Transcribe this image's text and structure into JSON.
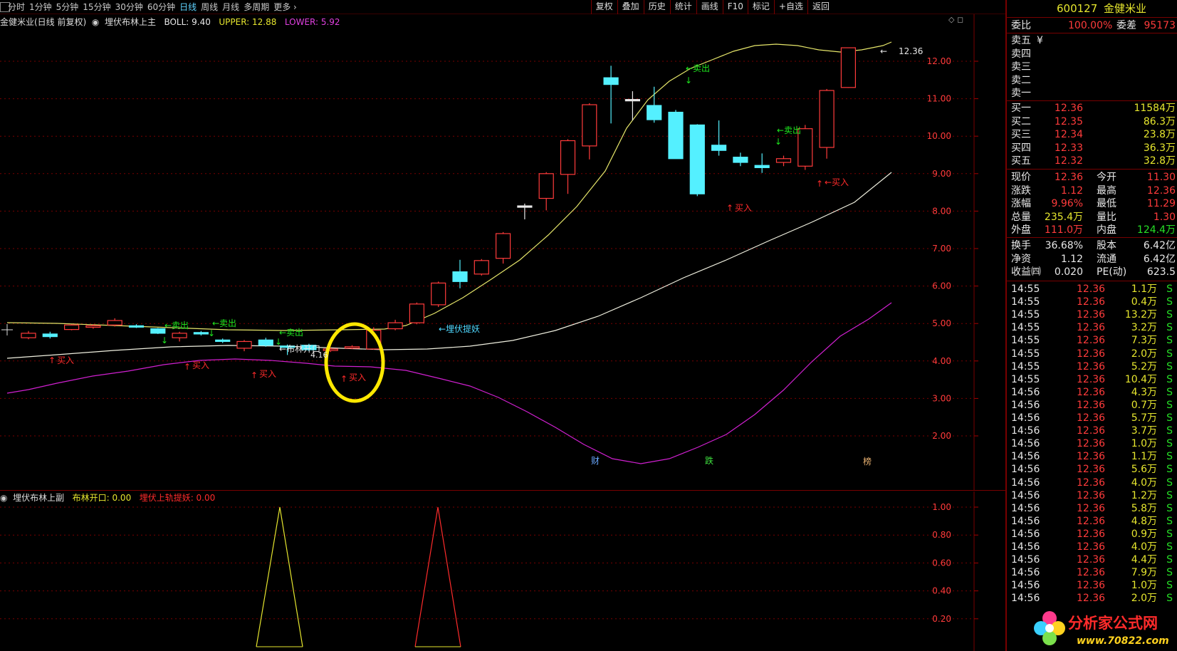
{
  "toolbar": {
    "periods": [
      "分时",
      "1分钟",
      "5分钟",
      "15分钟",
      "30分钟",
      "60分钟",
      "日线",
      "周线",
      "月线",
      "多周期",
      "更多"
    ],
    "active_period": "日线",
    "tools": [
      "复权",
      "叠加",
      "历史",
      "统计",
      "画线",
      "F10",
      "标记",
      "+自选",
      "返回"
    ]
  },
  "main_chart": {
    "header_name": "金健米业(日线 前复权)",
    "indicator_name": "埋伏布林上主",
    "boll_label": "BOLL: 9.40",
    "upper_label": "UPPER: 12.88",
    "lower_label": "LOWER: 5.92",
    "y_ticks": [
      "12.00",
      "11.00",
      "10.00",
      "9.00",
      "8.00",
      "7.00",
      "6.00",
      "5.00",
      "4.00",
      "3.00",
      "2.00"
    ],
    "last_price_label": "12.36",
    "low_label": "4.16",
    "annotations": {
      "buy": "买入",
      "sell": "卖出",
      "arrow_sell": "←卖出",
      "arrow_buy": "←买入",
      "bollinger_open": "←布林开口",
      "ambush": "←埋伏提妖"
    },
    "event_markers": [
      "财",
      "跌",
      "榜"
    ]
  },
  "sub_chart": {
    "indicator_name": "埋伏布林上副",
    "open_label": "布林开口: 0.00",
    "ambush_label": "埋伏上轨提妖: 0.00",
    "y_ticks": [
      "1.00",
      "0.80",
      "0.60",
      "0.40",
      "0.20"
    ]
  },
  "panel": {
    "code": "600127",
    "name": "金健米业",
    "weibi_label": "委比",
    "weibi_value": "100.00%",
    "weicha_label": "委差",
    "weicha_value": "95173",
    "asks": [
      {
        "label": "卖五",
        "price": "¥",
        "vol": ""
      },
      {
        "label": "卖四",
        "price": "",
        "vol": ""
      },
      {
        "label": "卖三",
        "price": "",
        "vol": ""
      },
      {
        "label": "卖二",
        "price": "",
        "vol": ""
      },
      {
        "label": "卖一",
        "price": "",
        "vol": ""
      }
    ],
    "bids": [
      {
        "label": "买一",
        "price": "12.36",
        "vol": "11584万"
      },
      {
        "label": "买二",
        "price": "12.35",
        "vol": "86.3万"
      },
      {
        "label": "买三",
        "price": "12.34",
        "vol": "23.8万"
      },
      {
        "label": "买四",
        "price": "12.33",
        "vol": "36.3万"
      },
      {
        "label": "买五",
        "price": "12.32",
        "vol": "32.8万"
      }
    ],
    "quote": [
      {
        "l1": "现价",
        "v1": "12.36",
        "l2": "今开",
        "v2": "11.30"
      },
      {
        "l1": "涨跌",
        "v1": "1.12",
        "l2": "最高",
        "v2": "12.36"
      },
      {
        "l1": "涨幅",
        "v1": "9.96%",
        "l2": "最低",
        "v2": "11.29"
      },
      {
        "l1": "总量",
        "v1": "235.4万",
        "l2": "量比",
        "v2": "1.30"
      },
      {
        "l1": "外盘",
        "v1": "111.0万",
        "l2": "内盘",
        "v2": "124.4万"
      }
    ],
    "fundamentals": [
      {
        "l1": "换手",
        "v1": "36.68%",
        "l2": "股本",
        "v2": "6.42亿"
      },
      {
        "l1": "净资",
        "v1": "1.12",
        "l2": "流通",
        "v2": "6.42亿"
      },
      {
        "l1": "收益㈣",
        "v1": "0.020",
        "l2": "PE(动)",
        "v2": "623.5"
      }
    ],
    "ticks": [
      {
        "t": "14:55",
        "p": "12.36",
        "v": "1.1万",
        "s": "S"
      },
      {
        "t": "14:55",
        "p": "12.36",
        "v": "0.4万",
        "s": "S"
      },
      {
        "t": "14:55",
        "p": "12.36",
        "v": "13.2万",
        "s": "S"
      },
      {
        "t": "14:55",
        "p": "12.36",
        "v": "3.2万",
        "s": "S"
      },
      {
        "t": "14:55",
        "p": "12.36",
        "v": "7.3万",
        "s": "S"
      },
      {
        "t": "14:55",
        "p": "12.36",
        "v": "2.0万",
        "s": "S"
      },
      {
        "t": "14:55",
        "p": "12.36",
        "v": "5.2万",
        "s": "S"
      },
      {
        "t": "14:55",
        "p": "12.36",
        "v": "10.4万",
        "s": "S"
      },
      {
        "t": "14:56",
        "p": "12.36",
        "v": "4.3万",
        "s": "S"
      },
      {
        "t": "14:56",
        "p": "12.36",
        "v": "0.7万",
        "s": "S"
      },
      {
        "t": "14:56",
        "p": "12.36",
        "v": "5.7万",
        "s": "S"
      },
      {
        "t": "14:56",
        "p": "12.36",
        "v": "3.7万",
        "s": "S"
      },
      {
        "t": "14:56",
        "p": "12.36",
        "v": "1.0万",
        "s": "S"
      },
      {
        "t": "14:56",
        "p": "12.36",
        "v": "1.1万",
        "s": "S"
      },
      {
        "t": "14:56",
        "p": "12.36",
        "v": "5.6万",
        "s": "S"
      },
      {
        "t": "14:56",
        "p": "12.36",
        "v": "4.0万",
        "s": "S"
      },
      {
        "t": "14:56",
        "p": "12.36",
        "v": "1.2万",
        "s": "S"
      },
      {
        "t": "14:56",
        "p": "12.36",
        "v": "5.8万",
        "s": "S"
      },
      {
        "t": "14:56",
        "p": "12.36",
        "v": "4.8万",
        "s": "S"
      },
      {
        "t": "14:56",
        "p": "12.36",
        "v": "0.9万",
        "s": "S"
      },
      {
        "t": "14:56",
        "p": "12.36",
        "v": "4.0万",
        "s": "S"
      },
      {
        "t": "14:56",
        "p": "12.36",
        "v": "4.4万",
        "s": "S"
      },
      {
        "t": "14:56",
        "p": "12.36",
        "v": "7.9万",
        "s": "S"
      },
      {
        "t": "14:56",
        "p": "12.36",
        "v": "1.0万",
        "s": "S"
      },
      {
        "t": "14:56",
        "p": "12.36",
        "v": "2.0万",
        "s": "S"
      }
    ]
  },
  "watermark": {
    "text": "分析家公式网",
    "url": "www.70822.com"
  },
  "chart_data": {
    "type": "candlestick",
    "ylim": [
      1.6,
      12.9
    ],
    "candles": [
      {
        "o": 4.62,
        "c": 4.74,
        "h": 4.8,
        "l": 4.58
      },
      {
        "o": 4.72,
        "c": 4.65,
        "h": 4.78,
        "l": 4.6
      },
      {
        "o": 4.84,
        "c": 4.96,
        "h": 4.98,
        "l": 4.82
      },
      {
        "o": 4.9,
        "c": 4.94,
        "h": 4.98,
        "l": 4.86
      },
      {
        "o": 4.96,
        "c": 5.08,
        "h": 5.14,
        "l": 4.92
      },
      {
        "o": 4.94,
        "c": 4.92,
        "h": 4.98,
        "l": 4.88
      },
      {
        "o": 4.86,
        "c": 4.74,
        "h": 4.88,
        "l": 4.72
      },
      {
        "o": 4.62,
        "c": 4.74,
        "h": 4.78,
        "l": 4.52
      },
      {
        "o": 4.76,
        "c": 4.72,
        "h": 4.8,
        "l": 4.68
      },
      {
        "o": 4.56,
        "c": 4.52,
        "h": 4.6,
        "l": 4.48
      },
      {
        "o": 4.34,
        "c": 4.52,
        "h": 4.56,
        "l": 4.26
      },
      {
        "o": 4.56,
        "c": 4.42,
        "h": 4.62,
        "l": 4.38
      },
      {
        "o": 4.4,
        "c": 4.38,
        "h": 4.44,
        "l": 4.16
      },
      {
        "o": 4.42,
        "c": 4.3,
        "h": 4.46,
        "l": 4.26
      },
      {
        "o": 4.28,
        "c": 4.32,
        "h": 4.36,
        "l": 4.24
      },
      {
        "o": 4.36,
        "c": 4.38,
        "h": 4.42,
        "l": 4.32
      },
      {
        "o": 4.32,
        "c": 4.82,
        "h": 4.9,
        "l": 4.3
      },
      {
        "o": 4.86,
        "c": 5.02,
        "h": 5.1,
        "l": 4.82
      },
      {
        "o": 5.02,
        "c": 5.52,
        "h": 5.56,
        "l": 4.98
      },
      {
        "o": 5.5,
        "c": 6.08,
        "h": 6.12,
        "l": 5.44
      },
      {
        "o": 6.38,
        "c": 6.12,
        "h": 6.7,
        "l": 5.94
      },
      {
        "o": 6.32,
        "c": 6.68,
        "h": 6.72,
        "l": 6.28
      },
      {
        "o": 6.74,
        "c": 7.4,
        "h": 7.44,
        "l": 6.6
      },
      {
        "o": 8.14,
        "c": 8.14,
        "h": 8.2,
        "l": 7.78
      },
      {
        "o": 8.34,
        "c": 9.0,
        "h": 9.04,
        "l": 8.02
      },
      {
        "o": 8.98,
        "c": 9.88,
        "h": 9.92,
        "l": 8.46
      },
      {
        "o": 9.74,
        "c": 10.84,
        "h": 10.88,
        "l": 9.38
      },
      {
        "o": 11.56,
        "c": 11.38,
        "h": 11.88,
        "l": 10.34
      },
      {
        "o": 10.98,
        "c": 10.98,
        "h": 11.2,
        "l": 10.42
      },
      {
        "o": 10.82,
        "c": 10.44,
        "h": 11.32,
        "l": 10.36
      },
      {
        "o": 10.64,
        "c": 9.4,
        "h": 10.7,
        "l": 9.4
      },
      {
        "o": 10.3,
        "c": 8.46,
        "h": 10.32,
        "l": 8.4
      },
      {
        "o": 9.76,
        "c": 9.62,
        "h": 10.42,
        "l": 9.48
      },
      {
        "o": 9.44,
        "c": 9.3,
        "h": 9.56,
        "l": 9.2
      },
      {
        "o": 9.22,
        "c": 9.16,
        "h": 9.54,
        "l": 9.02
      },
      {
        "o": 9.3,
        "c": 9.4,
        "h": 9.48,
        "l": 9.2
      },
      {
        "o": 9.2,
        "c": 10.2,
        "h": 10.3,
        "l": 9.1
      },
      {
        "o": 9.7,
        "c": 11.22,
        "h": 11.26,
        "l": 9.4
      },
      {
        "o": 11.3,
        "c": 12.36,
        "h": 12.36,
        "l": 11.29
      }
    ]
  }
}
